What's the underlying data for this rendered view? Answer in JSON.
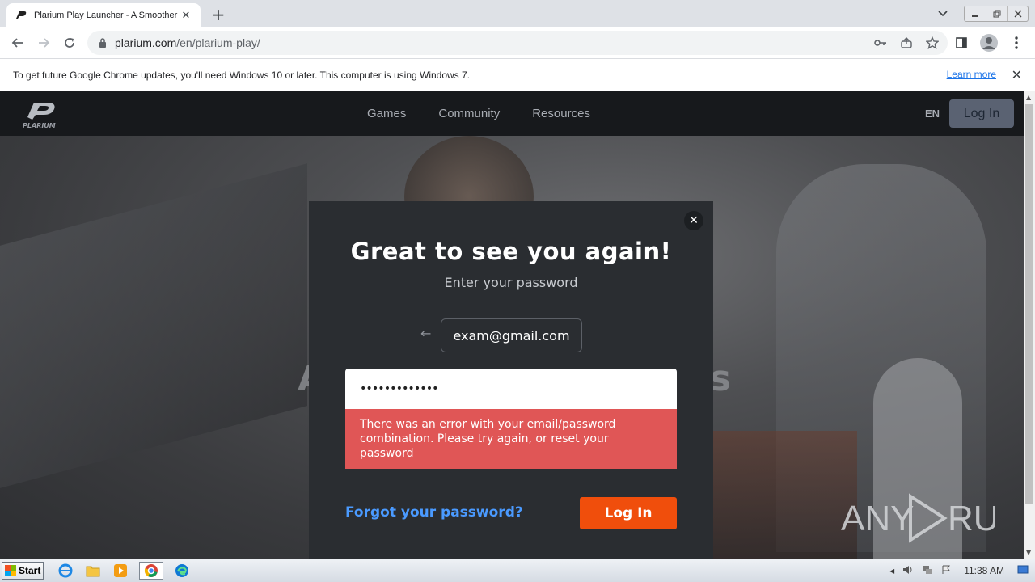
{
  "browser": {
    "tab_title": "Plarium Play Launcher - A Smoother",
    "tab_close": "✕",
    "new_tab": "+",
    "url_host": "plarium.com",
    "url_path": "/en/plarium-play/",
    "infobar_text": "To get future Google Chrome updates, you'll need Windows 10 or later. This computer is using Windows 7.",
    "infobar_link": "Learn more",
    "infobar_close": "✕"
  },
  "site": {
    "nav": [
      "Games",
      "Community",
      "Resources"
    ],
    "lang": "EN",
    "login": "Log In",
    "bg_title_left": "A",
    "bg_title_right": "rs"
  },
  "modal": {
    "close": "✕",
    "title": "Great to see you again!",
    "subtitle": "Enter your password",
    "back_arrow": "←",
    "email": "exam@gmail.com",
    "password_value": "•••••••••••••",
    "error": "There was an error with your email/password combination. Please try again, or reset your password",
    "forgot": "Forgot your password?",
    "login": "Log In"
  },
  "watermark": "ANY RUN",
  "taskbar": {
    "start": "Start",
    "clock": "11:38 AM"
  },
  "colors": {
    "accent_orange": "#f04e0c",
    "error_red": "#e05656",
    "link_blue": "#4a9aff",
    "header_bg": "#17191c"
  }
}
